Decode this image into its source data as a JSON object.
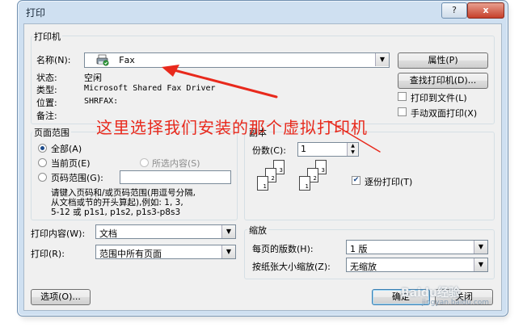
{
  "window": {
    "title": "打印",
    "help_label": "?",
    "close_label": "x"
  },
  "printer": {
    "group_label": "打印机",
    "name_label": "名称(N):",
    "name_value": "Fax",
    "status_label": "状态:",
    "status_value": "空闲",
    "type_label": "类型:",
    "type_value": "Microsoft Shared Fax Driver",
    "where_label": "位置:",
    "where_value": "SHRFAX:",
    "comment_label": "备注:",
    "properties_button": "属性(P)",
    "find_printer_button": "查找打印机(D)...",
    "print_to_file_label": "打印到文件(L)",
    "print_to_file_checked": false,
    "manual_duplex_label": "手动双面打印(X)",
    "manual_duplex_checked": false
  },
  "annotation": {
    "text": "这里选择我们安装的那个虚拟打印机",
    "color": "#e8291c"
  },
  "page_range": {
    "group_label": "页面范围",
    "all_label": "全部(A)",
    "current_label": "当前页(E)",
    "selection_label": "所选内容(S)",
    "pages_label": "页码范围(G):",
    "pages_value": "",
    "selected": "all",
    "hint_line1": "请键入页码和/或页码范围(用逗号分隔,",
    "hint_line2": "从文档或节的开头算起),例如: 1, 3,",
    "hint_line3": "5-12 或 p1s1, p1s2, p1s3-p8s3"
  },
  "copies": {
    "group_label": "副本",
    "count_label": "份数(C):",
    "count_value": "1",
    "collate_label": "逐份打印(T)",
    "collate_checked": true,
    "pages_a": [
      "3",
      "2",
      "1"
    ],
    "pages_b": [
      "3",
      "2",
      "1"
    ]
  },
  "print_what": {
    "label": "打印内容(W):",
    "value": "文档"
  },
  "print": {
    "label": "打印(R):",
    "value": "范围中所有页面"
  },
  "zoom": {
    "group_label": "缩放",
    "pages_per_sheet_label": "每页的版数(H):",
    "pages_per_sheet_value": "1 版",
    "scale_label": "按纸张大小缩放(Z):",
    "scale_value": "无缩放"
  },
  "footer": {
    "options_button": "选项(O)...",
    "ok_button": "确定",
    "close_button": "关闭"
  },
  "watermark": {
    "text": "Baidu经验",
    "sub": "jingyan.baidu.com"
  }
}
